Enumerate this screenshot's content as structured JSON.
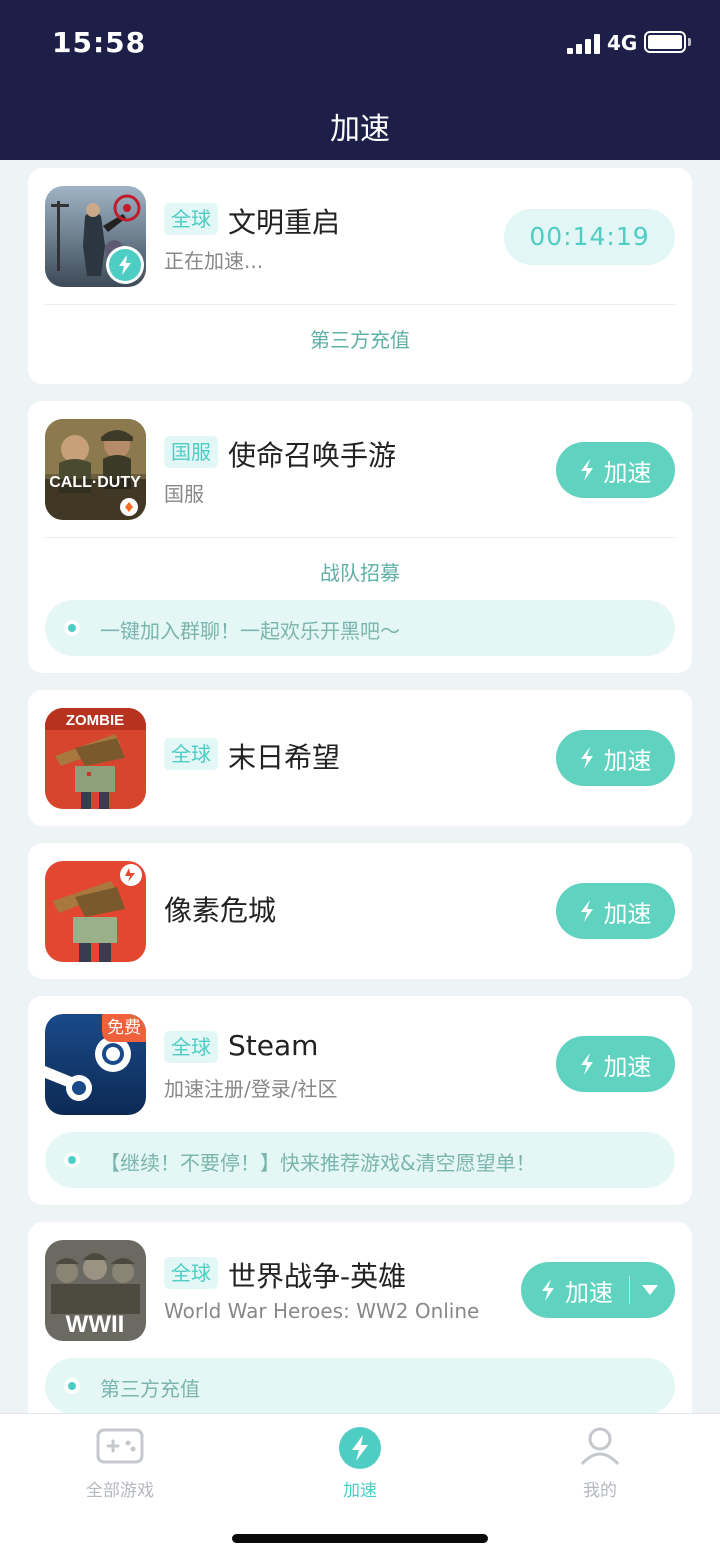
{
  "status_bar": {
    "time": "15:58",
    "network": "4G"
  },
  "header": {
    "title": "加速"
  },
  "games": [
    {
      "tag": "全球",
      "name": "文明重启",
      "subtitle": "正在加速...",
      "timer": "00:14:19",
      "link": "第三方充值",
      "icon": "civilization-game-icon"
    },
    {
      "tag": "国服",
      "name": "使命召唤手游",
      "subtitle": "国服",
      "button": "加速",
      "link": "战队招募",
      "notice": "一键加入群聊！一起欢乐开黑吧～",
      "icon": "call-of-duty-game-icon"
    },
    {
      "tag": "全球",
      "name": "末日希望",
      "button": "加速",
      "icon": "zombie-game-icon"
    },
    {
      "name": "像素危城",
      "button": "加速",
      "icon": "pixel-city-game-icon"
    },
    {
      "tag": "全球",
      "name": "Steam",
      "subtitle": "加速注册/登录/社区",
      "badge": "免费",
      "button": "加速",
      "notice": "【继续！不要停！】快来推荐游戏&清空愿望单！",
      "icon": "steam-icon"
    },
    {
      "tag": "全球",
      "name": "世界战争-英雄",
      "subtitle": "World War Heroes: WW2 Online",
      "button": "加速",
      "notice": "第三方充值",
      "icon": "wwii-game-icon"
    }
  ],
  "tabbar": [
    {
      "label": "全部游戏",
      "icon": "gamepad-icon"
    },
    {
      "label": "加速",
      "icon": "bolt-icon",
      "active": true
    },
    {
      "label": "我的",
      "icon": "user-icon"
    }
  ],
  "colors": {
    "header": "#1d1f48",
    "accent": "#4ecdc4",
    "button": "#5fd3c0",
    "background": "#eef3f6"
  }
}
